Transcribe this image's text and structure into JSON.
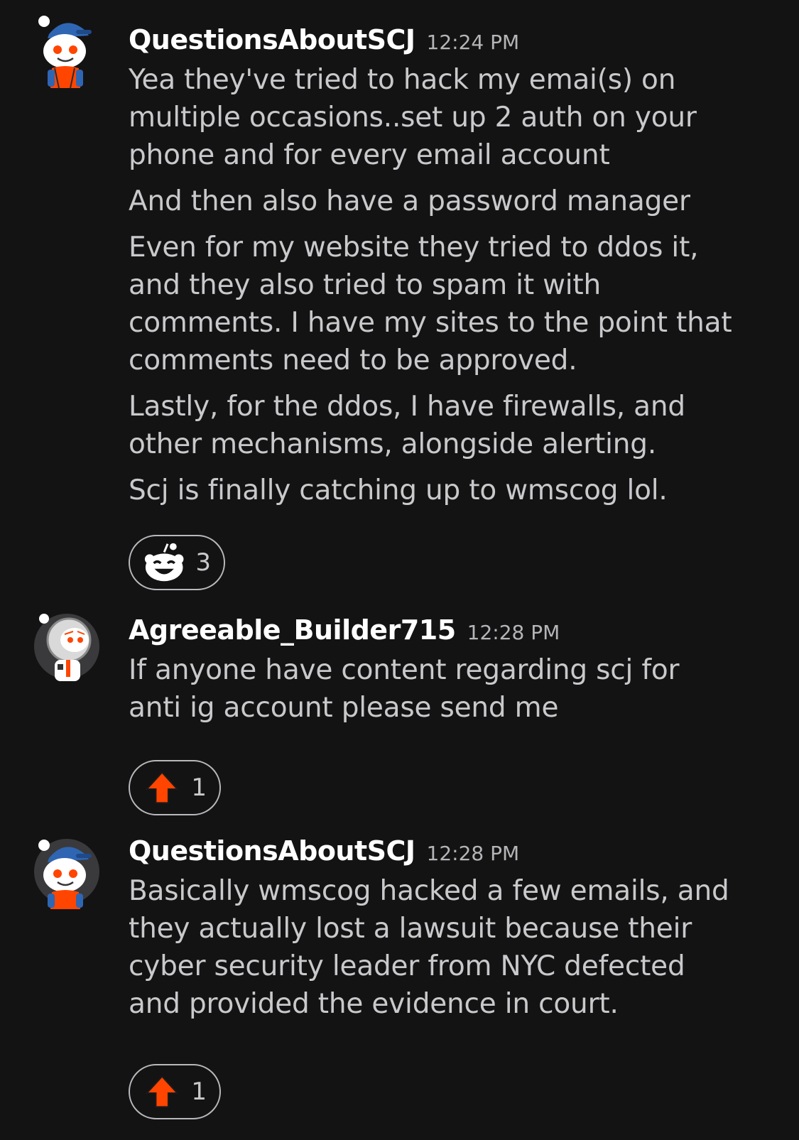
{
  "messages": [
    {
      "username": "QuestionsAboutSCJ",
      "timestamp": "12:24 PM",
      "avatar_icon": "snoo-blue-cap-avatar",
      "paragraphs": [
        [
          "Yea they've tried to hack my emai(s) on",
          "multiple occasions..set up 2 auth on your",
          "phone and for every email account"
        ],
        [
          "And then also have a password manager"
        ],
        [
          "Even for my website they tried to ddos it,",
          "and they also tried to spam it with",
          "comments. I have my sites to the point that",
          "comments need to be approved."
        ],
        [
          "Lastly, for the ddos, I have firewalls, and",
          "other mechanisms, alongside alerting."
        ],
        [
          "Scj is finally catching up to wmscog lol."
        ]
      ],
      "reaction": {
        "icon": "laughing-snoo-icon",
        "count": "3"
      }
    },
    {
      "username": "Agreeable_Builder715",
      "timestamp": "12:28 PM",
      "avatar_icon": "snoo-astronaut-avatar",
      "paragraphs": [
        [
          "If anyone have content regarding scj for",
          "anti ig account please send me"
        ]
      ],
      "reaction": {
        "icon": "upvote-arrow-icon",
        "count": "1"
      }
    },
    {
      "username": "QuestionsAboutSCJ",
      "timestamp": "12:28 PM",
      "avatar_icon": "snoo-blue-cap-avatar",
      "paragraphs": [
        [
          "Basically wmscog hacked a few emails, and",
          "they actually lost a lawsuit because their",
          "cyber security leader from NYC defected",
          "and provided the evidence in court."
        ]
      ],
      "reaction": {
        "icon": "upvote-arrow-icon",
        "count": "1"
      }
    }
  ],
  "colors": {
    "background": "#131314",
    "username": "#ffffff",
    "body_text": "#c9c9cc",
    "timestamp": "#b5b5b8",
    "upvote": "#ff4500",
    "pill_border": "#b9b9bc"
  }
}
